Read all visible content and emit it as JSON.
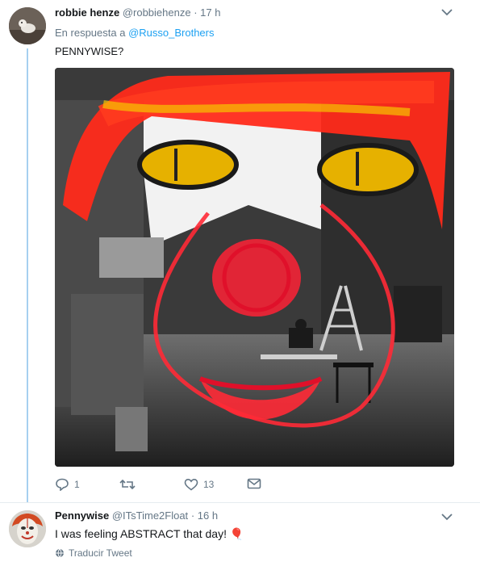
{
  "tweet1": {
    "name": "robbie henze",
    "handle": "@robbiehenze",
    "separator": "·",
    "time": "17 h",
    "reply_prefix": "En respuesta a",
    "reply_handle": "@Russo_Brothers",
    "text": "PENNYWISE?",
    "counts": {
      "reply": "1",
      "retweet": "",
      "like": "13"
    }
  },
  "tweet2": {
    "name": "Pennywise",
    "handle": "@ITsTime2Float",
    "separator": "·",
    "time": "16 h",
    "text": "I was feeling ABSTRACT that day! 🎈",
    "translate_label": "Traducir Tweet"
  },
  "icons": [
    "chevron-down-icon",
    "reply-icon",
    "retweet-icon",
    "like-icon",
    "direct-message-icon",
    "globe-icon"
  ],
  "colors": {
    "link": "#1da1f2",
    "thread_line": "#a6d0f0",
    "secondary_text": "#657786"
  }
}
